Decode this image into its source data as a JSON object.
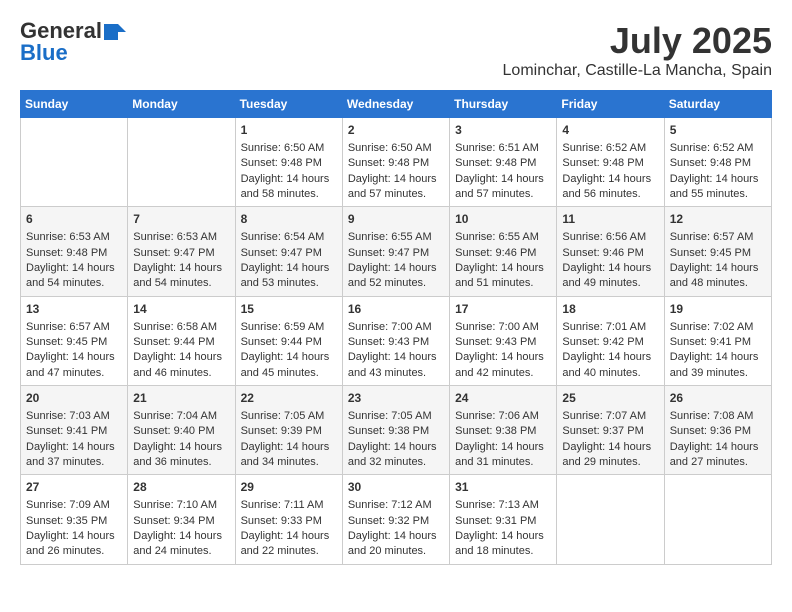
{
  "header": {
    "logo_general": "General",
    "logo_blue": "Blue",
    "month_title": "July 2025",
    "location": "Lominchar, Castille-La Mancha, Spain"
  },
  "weekdays": [
    "Sunday",
    "Monday",
    "Tuesday",
    "Wednesday",
    "Thursday",
    "Friday",
    "Saturday"
  ],
  "weeks": [
    [
      {
        "day": "",
        "sunrise": "",
        "sunset": "",
        "daylight": ""
      },
      {
        "day": "",
        "sunrise": "",
        "sunset": "",
        "daylight": ""
      },
      {
        "day": "1",
        "sunrise": "Sunrise: 6:50 AM",
        "sunset": "Sunset: 9:48 PM",
        "daylight": "Daylight: 14 hours and 58 minutes."
      },
      {
        "day": "2",
        "sunrise": "Sunrise: 6:50 AM",
        "sunset": "Sunset: 9:48 PM",
        "daylight": "Daylight: 14 hours and 57 minutes."
      },
      {
        "day": "3",
        "sunrise": "Sunrise: 6:51 AM",
        "sunset": "Sunset: 9:48 PM",
        "daylight": "Daylight: 14 hours and 57 minutes."
      },
      {
        "day": "4",
        "sunrise": "Sunrise: 6:52 AM",
        "sunset": "Sunset: 9:48 PM",
        "daylight": "Daylight: 14 hours and 56 minutes."
      },
      {
        "day": "5",
        "sunrise": "Sunrise: 6:52 AM",
        "sunset": "Sunset: 9:48 PM",
        "daylight": "Daylight: 14 hours and 55 minutes."
      }
    ],
    [
      {
        "day": "6",
        "sunrise": "Sunrise: 6:53 AM",
        "sunset": "Sunset: 9:48 PM",
        "daylight": "Daylight: 14 hours and 54 minutes."
      },
      {
        "day": "7",
        "sunrise": "Sunrise: 6:53 AM",
        "sunset": "Sunset: 9:47 PM",
        "daylight": "Daylight: 14 hours and 54 minutes."
      },
      {
        "day": "8",
        "sunrise": "Sunrise: 6:54 AM",
        "sunset": "Sunset: 9:47 PM",
        "daylight": "Daylight: 14 hours and 53 minutes."
      },
      {
        "day": "9",
        "sunrise": "Sunrise: 6:55 AM",
        "sunset": "Sunset: 9:47 PM",
        "daylight": "Daylight: 14 hours and 52 minutes."
      },
      {
        "day": "10",
        "sunrise": "Sunrise: 6:55 AM",
        "sunset": "Sunset: 9:46 PM",
        "daylight": "Daylight: 14 hours and 51 minutes."
      },
      {
        "day": "11",
        "sunrise": "Sunrise: 6:56 AM",
        "sunset": "Sunset: 9:46 PM",
        "daylight": "Daylight: 14 hours and 49 minutes."
      },
      {
        "day": "12",
        "sunrise": "Sunrise: 6:57 AM",
        "sunset": "Sunset: 9:45 PM",
        "daylight": "Daylight: 14 hours and 48 minutes."
      }
    ],
    [
      {
        "day": "13",
        "sunrise": "Sunrise: 6:57 AM",
        "sunset": "Sunset: 9:45 PM",
        "daylight": "Daylight: 14 hours and 47 minutes."
      },
      {
        "day": "14",
        "sunrise": "Sunrise: 6:58 AM",
        "sunset": "Sunset: 9:44 PM",
        "daylight": "Daylight: 14 hours and 46 minutes."
      },
      {
        "day": "15",
        "sunrise": "Sunrise: 6:59 AM",
        "sunset": "Sunset: 9:44 PM",
        "daylight": "Daylight: 14 hours and 45 minutes."
      },
      {
        "day": "16",
        "sunrise": "Sunrise: 7:00 AM",
        "sunset": "Sunset: 9:43 PM",
        "daylight": "Daylight: 14 hours and 43 minutes."
      },
      {
        "day": "17",
        "sunrise": "Sunrise: 7:00 AM",
        "sunset": "Sunset: 9:43 PM",
        "daylight": "Daylight: 14 hours and 42 minutes."
      },
      {
        "day": "18",
        "sunrise": "Sunrise: 7:01 AM",
        "sunset": "Sunset: 9:42 PM",
        "daylight": "Daylight: 14 hours and 40 minutes."
      },
      {
        "day": "19",
        "sunrise": "Sunrise: 7:02 AM",
        "sunset": "Sunset: 9:41 PM",
        "daylight": "Daylight: 14 hours and 39 minutes."
      }
    ],
    [
      {
        "day": "20",
        "sunrise": "Sunrise: 7:03 AM",
        "sunset": "Sunset: 9:41 PM",
        "daylight": "Daylight: 14 hours and 37 minutes."
      },
      {
        "day": "21",
        "sunrise": "Sunrise: 7:04 AM",
        "sunset": "Sunset: 9:40 PM",
        "daylight": "Daylight: 14 hours and 36 minutes."
      },
      {
        "day": "22",
        "sunrise": "Sunrise: 7:05 AM",
        "sunset": "Sunset: 9:39 PM",
        "daylight": "Daylight: 14 hours and 34 minutes."
      },
      {
        "day": "23",
        "sunrise": "Sunrise: 7:05 AM",
        "sunset": "Sunset: 9:38 PM",
        "daylight": "Daylight: 14 hours and 32 minutes."
      },
      {
        "day": "24",
        "sunrise": "Sunrise: 7:06 AM",
        "sunset": "Sunset: 9:38 PM",
        "daylight": "Daylight: 14 hours and 31 minutes."
      },
      {
        "day": "25",
        "sunrise": "Sunrise: 7:07 AM",
        "sunset": "Sunset: 9:37 PM",
        "daylight": "Daylight: 14 hours and 29 minutes."
      },
      {
        "day": "26",
        "sunrise": "Sunrise: 7:08 AM",
        "sunset": "Sunset: 9:36 PM",
        "daylight": "Daylight: 14 hours and 27 minutes."
      }
    ],
    [
      {
        "day": "27",
        "sunrise": "Sunrise: 7:09 AM",
        "sunset": "Sunset: 9:35 PM",
        "daylight": "Daylight: 14 hours and 26 minutes."
      },
      {
        "day": "28",
        "sunrise": "Sunrise: 7:10 AM",
        "sunset": "Sunset: 9:34 PM",
        "daylight": "Daylight: 14 hours and 24 minutes."
      },
      {
        "day": "29",
        "sunrise": "Sunrise: 7:11 AM",
        "sunset": "Sunset: 9:33 PM",
        "daylight": "Daylight: 14 hours and 22 minutes."
      },
      {
        "day": "30",
        "sunrise": "Sunrise: 7:12 AM",
        "sunset": "Sunset: 9:32 PM",
        "daylight": "Daylight: 14 hours and 20 minutes."
      },
      {
        "day": "31",
        "sunrise": "Sunrise: 7:13 AM",
        "sunset": "Sunset: 9:31 PM",
        "daylight": "Daylight: 14 hours and 18 minutes."
      },
      {
        "day": "",
        "sunrise": "",
        "sunset": "",
        "daylight": ""
      },
      {
        "day": "",
        "sunrise": "",
        "sunset": "",
        "daylight": ""
      }
    ]
  ]
}
